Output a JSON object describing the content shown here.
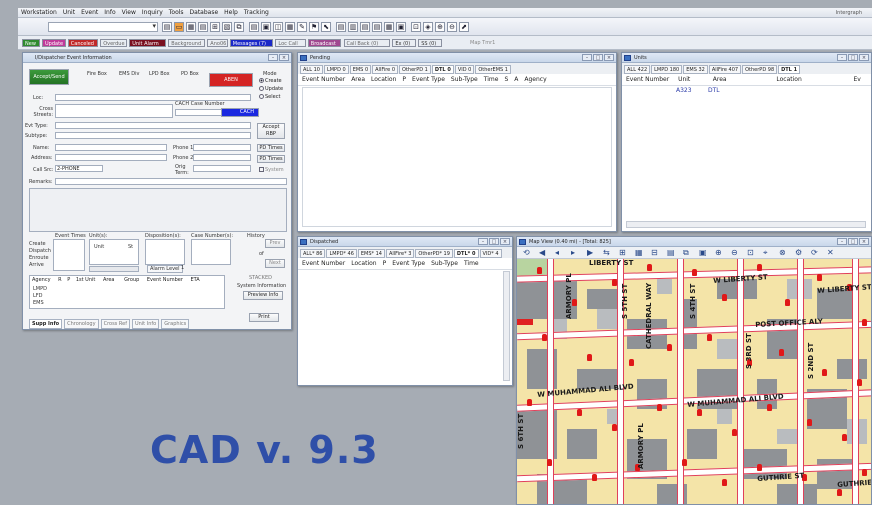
{
  "menu": {
    "items": [
      "Workstation",
      "Unit",
      "Event",
      "Info",
      "View",
      "Inquiry",
      "Tools",
      "Database",
      "Help",
      "Tracking"
    ],
    "brand": "Intergraph"
  },
  "statusbar": {
    "items": [
      {
        "label": "New",
        "bg": "#2f8a2f",
        "fg": "#ffffff"
      },
      {
        "label": "Update",
        "bg": "#c03a9a",
        "fg": "#ffffff"
      },
      {
        "label": "Canceled",
        "bg": "#c02828",
        "fg": "#ffffff"
      },
      {
        "label": "Overdue",
        "bg": "#e9edf3",
        "fg": "#666666"
      },
      {
        "label": "Unit Alarm",
        "bg": "#7a1020",
        "fg": "#ffffff"
      },
      {
        "label": "Background",
        "bg": "#e9edf3",
        "fg": "#666666"
      },
      {
        "label": "Ano06",
        "bg": "#e9edf3",
        "fg": "#666666"
      },
      {
        "label": "Messages (7)",
        "bg": "#1a28c8",
        "fg": "#ffffff"
      },
      {
        "label": "Loc Call",
        "bg": "#e9edf3",
        "fg": "#666666"
      },
      {
        "label": "Broadcast",
        "bg": "#a04890",
        "fg": "#ffffff"
      },
      {
        "label": "Call Back (0)",
        "bg": "#e9edf3",
        "fg": "#666666"
      },
      {
        "label": "Ex (0)",
        "bg": "#e9edf3",
        "fg": "#333333"
      },
      {
        "label": "SS (0)",
        "bg": "#e9edf3",
        "fg": "#333333"
      }
    ],
    "right_text": "Map Tmr1"
  },
  "event_info": {
    "title": "I/Dispatcher Event Information",
    "accept_send": "Accept/Send",
    "fire_box": "Fire Box",
    "ems_div": "EMS Div",
    "lpd_box": "LPD Box",
    "pd_box": "PD Box",
    "alert_button": "ABEN",
    "mode_label": "Mode",
    "mode_create": "Create",
    "mode_update": "Update",
    "mode_select": "Select",
    "loc_label": "Loc:",
    "cross_streets_label": "Cross Streets:",
    "cach_case_label": "CACH Case Number",
    "cach_button": "CACH",
    "evt_type_label": "Evt Type:",
    "subtype_label": "Subtype:",
    "accept_rbp": "Accept RBP",
    "name_label": "Name:",
    "phone1_label": "Phone 1:",
    "pd_times1": "PD Times",
    "address_label": "Address:",
    "phone2_label": "Phone 2:",
    "pd_times2": "PD Times",
    "call_src_label": "Call Src:",
    "call_src_value": "2-PHONE",
    "orig_term_label": "Orig Term:",
    "system_label": "System",
    "remarks_label": "Remarks:",
    "event_times_label": "Event Times",
    "units_label": "Unit(s):",
    "disposition_label": "Disposition(s):",
    "case_numbers_label": "Case Number(s):",
    "history_label": "History",
    "create_label": "Create",
    "dispatch_label": "Dispatch",
    "enroute_label": "Enroute",
    "arrive_label": "Arrive",
    "unit_value": "Unit",
    "unit_code": "St",
    "prev_button": "Prev",
    "of_label": "of",
    "next_button": "Next",
    "alarm_level": "Alarm Level",
    "alarm_value": "1",
    "agency_cols": [
      "Agency",
      "R",
      "P",
      "1st Unit",
      "Area",
      "Group",
      "Event Number",
      "ETA"
    ],
    "agencies": [
      "LMPD",
      "LFD",
      "EMS"
    ],
    "stacked_label": "STACKED",
    "system_info_label": "System Information",
    "preview_info": "Preview Info",
    "print_button": "Print",
    "bottom_tabs": [
      "Supp Info",
      "Chronology",
      "Cross Ref",
      "Unit Info",
      "Graphics"
    ]
  },
  "pending": {
    "title": "Pending",
    "tabs": [
      "ALL 10",
      "LMPD 0",
      "EMS 0",
      "AllFire 0",
      "OtherPD 1",
      "DTL 0",
      "VID 0",
      "OtherEMS 1"
    ],
    "active_tab": 5,
    "columns": [
      "Event Number",
      "Area",
      "Location",
      "P",
      "Event Type",
      "Sub-Type",
      "Time",
      "S",
      "A",
      "Agency"
    ]
  },
  "units": {
    "title": "Units",
    "tabs": [
      "ALL 422",
      "LMPD 180",
      "EMS 32",
      "AllFire 407",
      "OtherPD 98",
      "DTL 1"
    ],
    "active_tab": 5,
    "columns": [
      "Event Number",
      "Unit",
      "Area",
      "Location",
      "Ev"
    ],
    "rows": [
      {
        "event": "",
        "unit": "A323",
        "area": "DTL",
        "location": ""
      }
    ]
  },
  "dispatched": {
    "title": "Dispatched",
    "tabs": [
      "ALL* 86",
      "LMPD* 46",
      "EMS* 14",
      "AllFire* 3",
      "OtherPD* 19",
      "DTL* 0",
      "VID* 4"
    ],
    "active_tab": 5,
    "columns": [
      "Event Number",
      "Location",
      "P",
      "Event Type",
      "Sub-Type",
      "Time"
    ]
  },
  "map": {
    "title": "Map View (0.40 mi) - [Total: 825]",
    "streets": [
      "LIBERTY ST",
      "W LIBERTY ST",
      "W LIBERTY ST",
      "POST OFFICE ALY",
      "W MUHAMMAD ALI BLVD",
      "W MUHAMMAD ALI BLVD",
      "GUTHRIE ST",
      "GUTHRIE ST",
      "ARMORY PL",
      "S 5TH ST",
      "CATHEDRAL WAY",
      "S 4TH ST",
      "S 3RD ST",
      "S 2ND ST",
      "S 6TH ST",
      "ARMORY PL"
    ]
  },
  "overlay": {
    "caption": "CAD v. 9.3"
  }
}
